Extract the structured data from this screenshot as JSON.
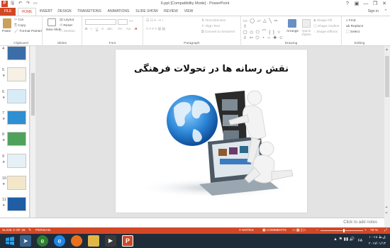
{
  "window": {
    "title": "6.ppt [Compatibility Mode] - PowerPoint",
    "sign_in": "Sign in",
    "controls": [
      "?",
      "▣",
      "—",
      "❐",
      "✕"
    ]
  },
  "tabs": [
    "FILE",
    "HOME",
    "INSERT",
    "DESIGN",
    "TRANSITIONS",
    "ANIMATIONS",
    "SLIDE SHOW",
    "REVIEW",
    "VIEW"
  ],
  "ribbon": {
    "clipboard": {
      "label": "Clipboard",
      "paste": "Paste",
      "cut": "Cut",
      "copy": "Copy",
      "format_painter": "Format Painter"
    },
    "slides": {
      "label": "Slides",
      "new_slide": "New Slide",
      "layout": "Layout",
      "reset": "Reset",
      "section": "Section"
    },
    "font": {
      "label": "Font"
    },
    "paragraph": {
      "label": "Paragraph",
      "text_direction": "Text Direction",
      "align_text": "Align Text",
      "convert_smartart": "Convert to SmartArt"
    },
    "drawing": {
      "label": "Drawing",
      "arrange": "Arrange",
      "quick_styles": "Quick Styles",
      "shape_fill": "Shape Fill",
      "shape_outline": "Shape Outline",
      "shape_effects": "Shape Effects"
    },
    "editing": {
      "label": "Editing",
      "find": "Find",
      "replace": "Replace",
      "select": "Select"
    }
  },
  "thumbnails": [
    {
      "num": "4"
    },
    {
      "num": "5"
    },
    {
      "num": "6"
    },
    {
      "num": "7"
    },
    {
      "num": "8"
    },
    {
      "num": "9"
    },
    {
      "num": "10"
    },
    {
      "num": "11"
    },
    {
      "num": "12"
    }
  ],
  "slide": {
    "title": "نقش رسانه ها در تحولات فرهنگی"
  },
  "notes": {
    "placeholder": "Click to add notes"
  },
  "status": {
    "slide_of": "SLIDE 2 OF 28",
    "language": "PERSIAN",
    "notes": "NOTES",
    "comments": "COMMENTS",
    "zoom": "78 %"
  },
  "taskbar": {
    "lang": "FA",
    "time": "۱۰:۱۸ ق.ظ",
    "date": "۲۰۱۷/۰۱/۱۳"
  }
}
